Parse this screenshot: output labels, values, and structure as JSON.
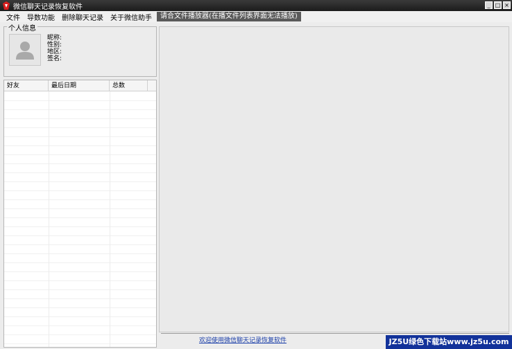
{
  "window": {
    "title": "微信聊天记录恢复软件",
    "buttons": {
      "minimize": "_",
      "maximize": "□",
      "close": "×"
    }
  },
  "menu": {
    "items": [
      "文件",
      "导数功能",
      "删除聊天记录",
      "关于微信助手"
    ],
    "active_item": "请合文件播放器(在播文件列表界面无法播放)"
  },
  "profile": {
    "group_title": "个人信息",
    "fields": [
      "昵称:",
      "性别:",
      "地区:",
      "签名:"
    ]
  },
  "list": {
    "columns": [
      "好友",
      "最后日期",
      "总数"
    ]
  },
  "footer": {
    "link": "欢迎使用微信聊天记录恢复软件"
  },
  "watermark": {
    "text": "JZ5U绿色下载站www.jz5u.com"
  }
}
